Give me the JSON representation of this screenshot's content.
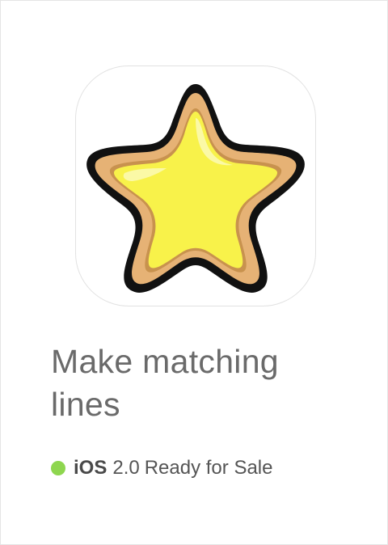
{
  "app": {
    "icon": "star-cookie-icon",
    "title": "Make matching lines",
    "platform": "iOS",
    "version": "2.0",
    "status": "Ready for Sale"
  },
  "colors": {
    "status_dot": "#8ed64f",
    "star_fill": "#f8f24a",
    "star_highlight": "#fbf9a6",
    "cookie": "#e6b275",
    "outline": "#111111"
  }
}
